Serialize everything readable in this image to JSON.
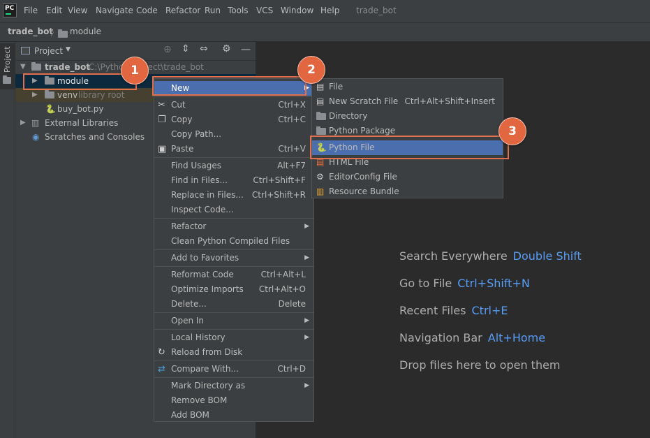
{
  "app": {
    "logo_text": "PC",
    "window_title": "trade_bot"
  },
  "menubar": [
    "File",
    "Edit",
    "View",
    "Navigate",
    "Code",
    "Refactor",
    "Run",
    "Tools",
    "VCS",
    "Window",
    "Help"
  ],
  "breadcrumb": {
    "project": "trade_bot",
    "folder": "module"
  },
  "side_stripe": {
    "label": "Project"
  },
  "project_panel": {
    "title": "Project",
    "tree": [
      {
        "name": "trade_bot",
        "note": "C:\\Python\\Project\\trade_bot"
      },
      {
        "name": "module",
        "note": ""
      },
      {
        "name": "venv",
        "note": "library root"
      },
      {
        "name": "buy_bot.py",
        "note": ""
      },
      {
        "name": "External Libraries",
        "note": ""
      },
      {
        "name": "Scratches and Consoles",
        "note": ""
      }
    ]
  },
  "context_menu": {
    "items": [
      {
        "label": "New",
        "shortcut": ""
      },
      {
        "label": "Cut",
        "shortcut": "Ctrl+X"
      },
      {
        "label": "Copy",
        "shortcut": "Ctrl+C"
      },
      {
        "label": "Copy Path...",
        "shortcut": ""
      },
      {
        "label": "Paste",
        "shortcut": "Ctrl+V"
      },
      {
        "label": "Find Usages",
        "shortcut": "Alt+F7"
      },
      {
        "label": "Find in Files...",
        "shortcut": "Ctrl+Shift+F"
      },
      {
        "label": "Replace in Files...",
        "shortcut": "Ctrl+Shift+R"
      },
      {
        "label": "Inspect Code...",
        "shortcut": ""
      },
      {
        "label": "Refactor",
        "shortcut": ""
      },
      {
        "label": "Clean Python Compiled Files",
        "shortcut": ""
      },
      {
        "label": "Add to Favorites",
        "shortcut": ""
      },
      {
        "label": "Reformat Code",
        "shortcut": "Ctrl+Alt+L"
      },
      {
        "label": "Optimize Imports",
        "shortcut": "Ctrl+Alt+O"
      },
      {
        "label": "Delete...",
        "shortcut": "Delete"
      },
      {
        "label": "Open In",
        "shortcut": ""
      },
      {
        "label": "Local History",
        "shortcut": ""
      },
      {
        "label": "Reload from Disk",
        "shortcut": ""
      },
      {
        "label": "Compare With...",
        "shortcut": "Ctrl+D"
      },
      {
        "label": "Mark Directory as",
        "shortcut": ""
      },
      {
        "label": "Remove BOM",
        "shortcut": ""
      },
      {
        "label": "Add BOM",
        "shortcut": ""
      }
    ]
  },
  "new_submenu": {
    "items": [
      {
        "label": "File",
        "shortcut": ""
      },
      {
        "label": "New Scratch File",
        "shortcut": "Ctrl+Alt+Shift+Insert"
      },
      {
        "label": "Directory",
        "shortcut": ""
      },
      {
        "label": "Python Package",
        "shortcut": ""
      },
      {
        "label": "Python File",
        "shortcut": ""
      },
      {
        "label": "HTML File",
        "shortcut": ""
      },
      {
        "label": "EditorConfig File",
        "shortcut": ""
      },
      {
        "label": "Resource Bundle",
        "shortcut": ""
      }
    ]
  },
  "editor_hints": [
    {
      "text": "Search Everywhere",
      "key": "Double Shift"
    },
    {
      "text": "Go to File",
      "key": "Ctrl+Shift+N"
    },
    {
      "text": "Recent Files",
      "key": "Ctrl+E"
    },
    {
      "text": "Navigation Bar",
      "key": "Alt+Home"
    },
    {
      "text": "Drop files here to open them",
      "key": ""
    }
  ],
  "callouts": [
    "1",
    "2",
    "3"
  ],
  "colors": {
    "selection": "#4b6eaf",
    "accent_link": "#589df6",
    "callout": "#e2663f"
  }
}
